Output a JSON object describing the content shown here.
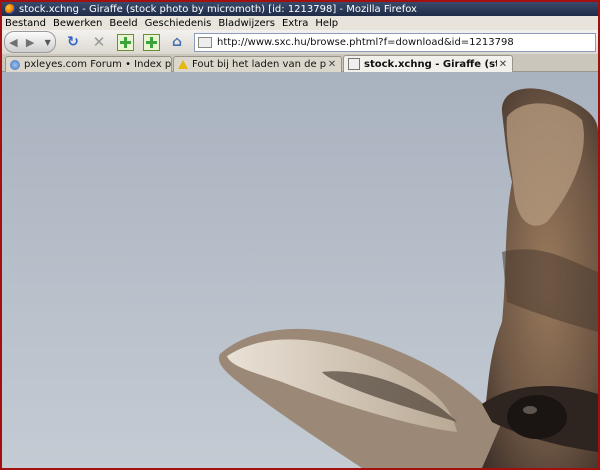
{
  "window": {
    "title": "stock.xchng - Giraffe (stock photo by micromoth) [id: 1213798] - Mozilla Firefox"
  },
  "menu": [
    "Bestand",
    "Bewerken",
    "Beeld",
    "Geschiedenis",
    "Bladwijzers",
    "Extra",
    "Help"
  ],
  "toolbar": {
    "back_icon": "back-arrow-icon",
    "forward_icon": "forward-arrow-icon",
    "url": "http://www.sxc.hu/browse.phtml?f=download&id=1213798"
  },
  "tabs": [
    {
      "label": "pxleyes.com Forum • Index page",
      "icon": "pxleyes-favicon",
      "active": false
    },
    {
      "label": "Fout bij het laden van de pagina",
      "icon": "warning-icon",
      "active": false
    },
    {
      "label": "stock.xchng - Giraffe (stock phot...",
      "icon": "site-favicon",
      "active": true
    }
  ],
  "colors": {
    "sky": "#a9b2be",
    "titlebar": "#2a3858",
    "frame": "#a30f0f"
  }
}
